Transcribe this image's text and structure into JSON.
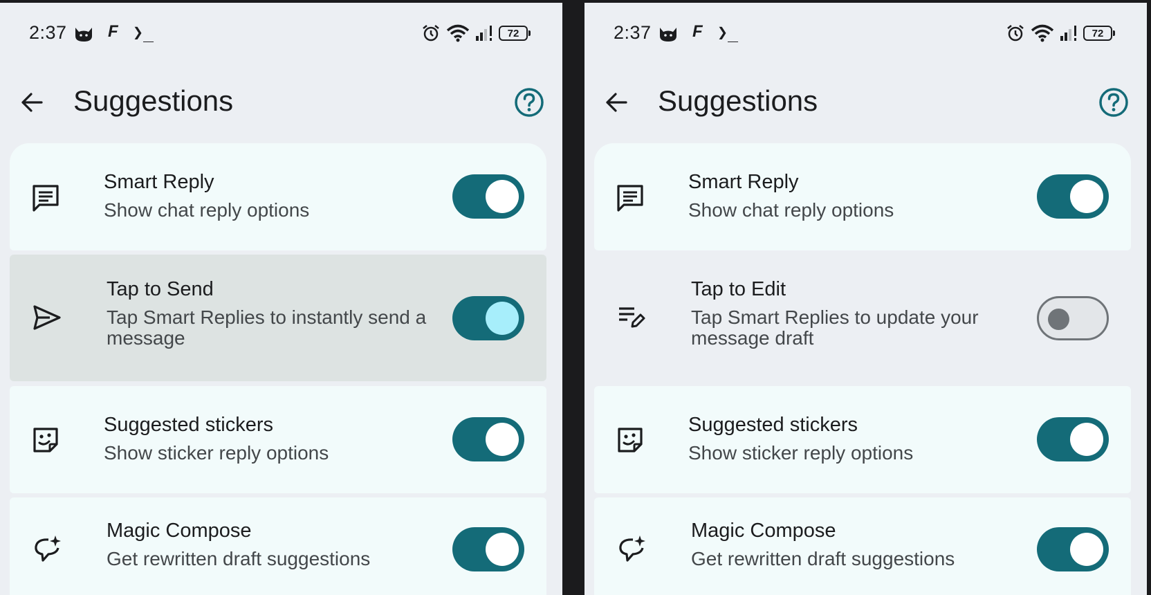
{
  "screens": [
    {
      "status": {
        "time": "2:37",
        "f_glyph": "F",
        "terminal_glyph": "❯_",
        "battery": "72"
      },
      "header": {
        "title": "Suggestions"
      },
      "settings": [
        {
          "title": "Smart Reply",
          "subtitle": "Show chat reply options",
          "icon": "message-lines-icon",
          "toggle": "on"
        },
        {
          "title": "Tap to Send",
          "subtitle": "Tap Smart Replies to instantly send a message",
          "icon": "send-icon",
          "toggle": "on"
        },
        {
          "title": "Suggested stickers",
          "subtitle": "Show sticker reply options",
          "icon": "sticker-icon",
          "toggle": "on"
        },
        {
          "title": "Magic Compose",
          "subtitle": "Get rewritten draft suggestions",
          "icon": "magic-compose-icon",
          "toggle": "on"
        }
      ]
    },
    {
      "status": {
        "time": "2:37",
        "f_glyph": "F",
        "terminal_glyph": "❯_",
        "battery": "72"
      },
      "header": {
        "title": "Suggestions"
      },
      "settings": [
        {
          "title": "Smart Reply",
          "subtitle": "Show chat reply options",
          "icon": "message-lines-icon",
          "toggle": "on"
        },
        {
          "title": "Tap to Edit",
          "subtitle": "Tap Smart Replies to update your message draft",
          "icon": "edit-list-icon",
          "toggle": "off"
        },
        {
          "title": "Suggested stickers",
          "subtitle": "Show sticker reply options",
          "icon": "sticker-icon",
          "toggle": "on"
        },
        {
          "title": "Magic Compose",
          "subtitle": "Get rewritten draft suggestions",
          "icon": "magic-compose-icon",
          "toggle": "on"
        }
      ]
    }
  ],
  "colors": {
    "accent": "#146b78",
    "help_icon": "#146b78",
    "card": "#f2fbfb",
    "background": "#eceff3"
  }
}
